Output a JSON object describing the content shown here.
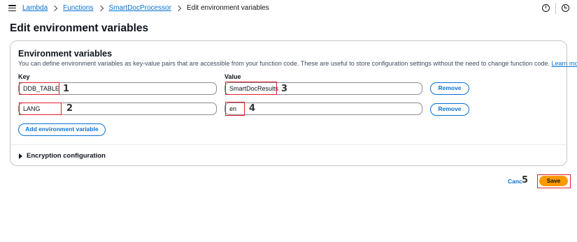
{
  "breadcrumb": {
    "items": [
      "Lambda",
      "Functions",
      "SmartDocProcessor"
    ],
    "current": "Edit environment variables"
  },
  "page": {
    "title": "Edit environment variables"
  },
  "panel": {
    "title": "Environment variables",
    "description": "You can define environment variables as key-value pairs that are accessible from your function code. These are useful to store configuration settings without the need to change function code.",
    "learn_more": "Learn more",
    "key_label": "Key",
    "value_label": "Value",
    "rows": [
      {
        "key": "DDB_TABLE",
        "value": "SmartDocResults",
        "remove": "Remove",
        "key_marker": "1",
        "value_marker": "3"
      },
      {
        "key": "LANG",
        "value": "en",
        "remove": "Remove",
        "key_marker": "2",
        "value_marker": "4"
      }
    ],
    "add_button": "Add environment variable",
    "encryption": "Encryption configuration"
  },
  "footer": {
    "cancel": "Cancel",
    "cancel_marker": "5",
    "save": "Save"
  },
  "colors": {
    "accent": "#0972d3",
    "save": "#ff9900",
    "highlight": "#e0202a"
  }
}
